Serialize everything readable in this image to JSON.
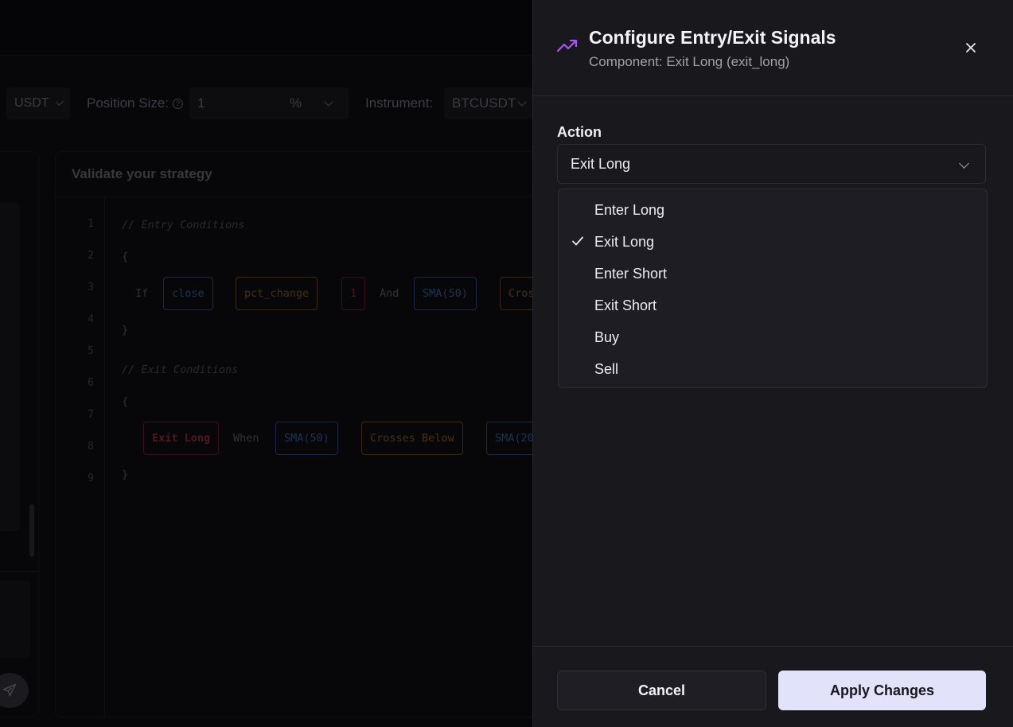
{
  "toolbar": {
    "currency": "USDT",
    "position_size_label": "Position Size:",
    "position_size_value": "1",
    "position_size_unit": "%",
    "instrument_label": "Instrument:",
    "instrument_value": "BTCUSDT"
  },
  "validate": {
    "title": "Validate your strategy",
    "line_numbers": [
      "1",
      "2",
      "3",
      "4",
      "5",
      "6",
      "7",
      "8",
      "9"
    ],
    "entry_comment": "// Entry Conditions",
    "exit_comment": "// Exit Conditions",
    "open_brace": "{",
    "close_brace": "}",
    "entry": {
      "if_kw": "If",
      "and_kw": "And",
      "tok1": "close",
      "tok2": "pct_change",
      "tok3": "1",
      "tok4": "SMA(50)",
      "tok5": "Cros"
    },
    "exit": {
      "when_kw": "When",
      "tok1": "Exit Long",
      "tok2": "SMA(50)",
      "tok3": "Crosses Below",
      "tok4": "SMA(20"
    }
  },
  "sheet": {
    "title": "Configure Entry/Exit Signals",
    "subtitle": "Component: Exit Long (exit_long)",
    "action_label": "Action",
    "selected_value": "Exit Long",
    "options": [
      "Enter Long",
      "Exit Long",
      "Enter Short",
      "Exit Short",
      "Buy",
      "Sell"
    ],
    "cancel_label": "Cancel",
    "apply_label": "Apply Changes"
  },
  "colors": {
    "accent_icon": "#a855f7",
    "apply_bg": "#e2e3fb",
    "sheet_bg": "#18181d"
  },
  "icons": {
    "sheet": "trending-up-icon",
    "close": "close-icon",
    "selected": "check-icon",
    "send": "send-icon"
  }
}
